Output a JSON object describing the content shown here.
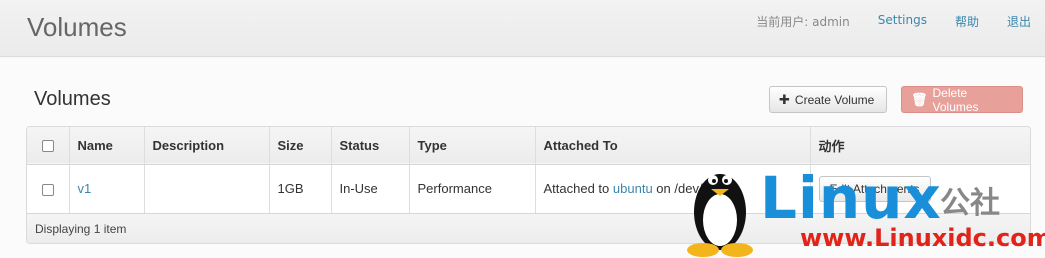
{
  "header": {
    "title": "Volumes",
    "user_label": "当前用户: admin",
    "settings": "Settings",
    "help": "帮助",
    "logout": "退出"
  },
  "main": {
    "section_title": "Volumes",
    "create_button": "Create Volume",
    "delete_button": "Delete Volumes"
  },
  "table": {
    "headers": {
      "name": "Name",
      "description": "Description",
      "size": "Size",
      "status": "Status",
      "type": "Type",
      "attached_to": "Attached To",
      "actions": "动作"
    },
    "rows": [
      {
        "name": "v1",
        "description": "",
        "size": "1GB",
        "status": "In-Use",
        "type": "Performance",
        "attached_prefix": "Attached to",
        "attached_instance": "ubuntu",
        "attached_suffix": "on /dev/v",
        "action": "Edit Attachments"
      }
    ],
    "footer": "Displaying 1 item"
  },
  "watermark": {
    "brand": "Linux",
    "brand_cn": "公社",
    "url": "www.Linuxidc.com"
  },
  "colors": {
    "link": "#3a87ad",
    "delete_button": "#e8a09a",
    "watermark_blue": "#1a8fd9",
    "watermark_red": "#e0241a"
  }
}
